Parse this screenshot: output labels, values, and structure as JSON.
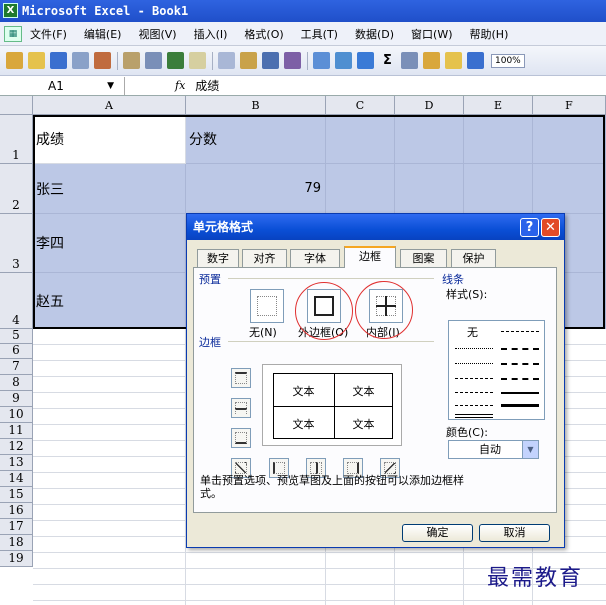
{
  "window": {
    "title": "Microsoft Excel - Book1"
  },
  "menubar": {
    "items": [
      "文件(F)",
      "编辑(E)",
      "视图(V)",
      "插入(I)",
      "格式(O)",
      "工具(T)",
      "数据(D)",
      "窗口(W)",
      "帮助(H)"
    ]
  },
  "toolbar": {
    "zoom": "100%",
    "sum_symbol": "Σ",
    "button_colors": [
      "#d9a73c",
      "#e5c24d",
      "#3a6fcf",
      "#8aa1c8",
      "#c06b3f",
      "#b9a06b",
      "#7a8fb8",
      "#3b7d3b",
      "#d6cfa0",
      "#a9b7d6",
      "#c9a24a",
      "#4c6fb0",
      "#7d5fa6",
      "#5c8fd6",
      "#4f8fd1",
      "#3a7ad6",
      "#d8b243",
      "#7a8fb8"
    ]
  },
  "formula_bar": {
    "name_box": "A1",
    "fx": "fx",
    "content": "成绩"
  },
  "sheet": {
    "columns": [
      "A",
      "B",
      "C",
      "D",
      "E",
      "F"
    ],
    "rows": [
      "1",
      "2",
      "3",
      "4",
      "5",
      "6",
      "7",
      "8",
      "9",
      "10",
      "11",
      "12",
      "13",
      "14",
      "15",
      "16",
      "17",
      "18",
      "19"
    ],
    "cells": {
      "A1": "成绩",
      "B1": "分数",
      "A2": "张三",
      "B2": "79",
      "A3": "李四",
      "A4": "赵五"
    }
  },
  "dialog": {
    "title": "单元格格式",
    "help": "?",
    "close": "✕",
    "tabs": [
      "数字",
      "对齐",
      "字体",
      "边框",
      "图案",
      "保护"
    ],
    "active_tab": "边框",
    "preset_section": "预置",
    "presets": [
      "无(N)",
      "外边框(O)",
      "内部(I)"
    ],
    "border_section": "边框",
    "preview_text": [
      "文本",
      "文本",
      "文本",
      "文本"
    ],
    "line_section": "线条",
    "style_label": "样式(S):",
    "style_none": "无",
    "color_label": "颜色(C):",
    "color_value": "自动",
    "hint": "单击预置选项、预览草图及上面的按钮可以添加边框样式。",
    "ok": "确定",
    "cancel": "取消"
  },
  "watermark": "最需教育"
}
